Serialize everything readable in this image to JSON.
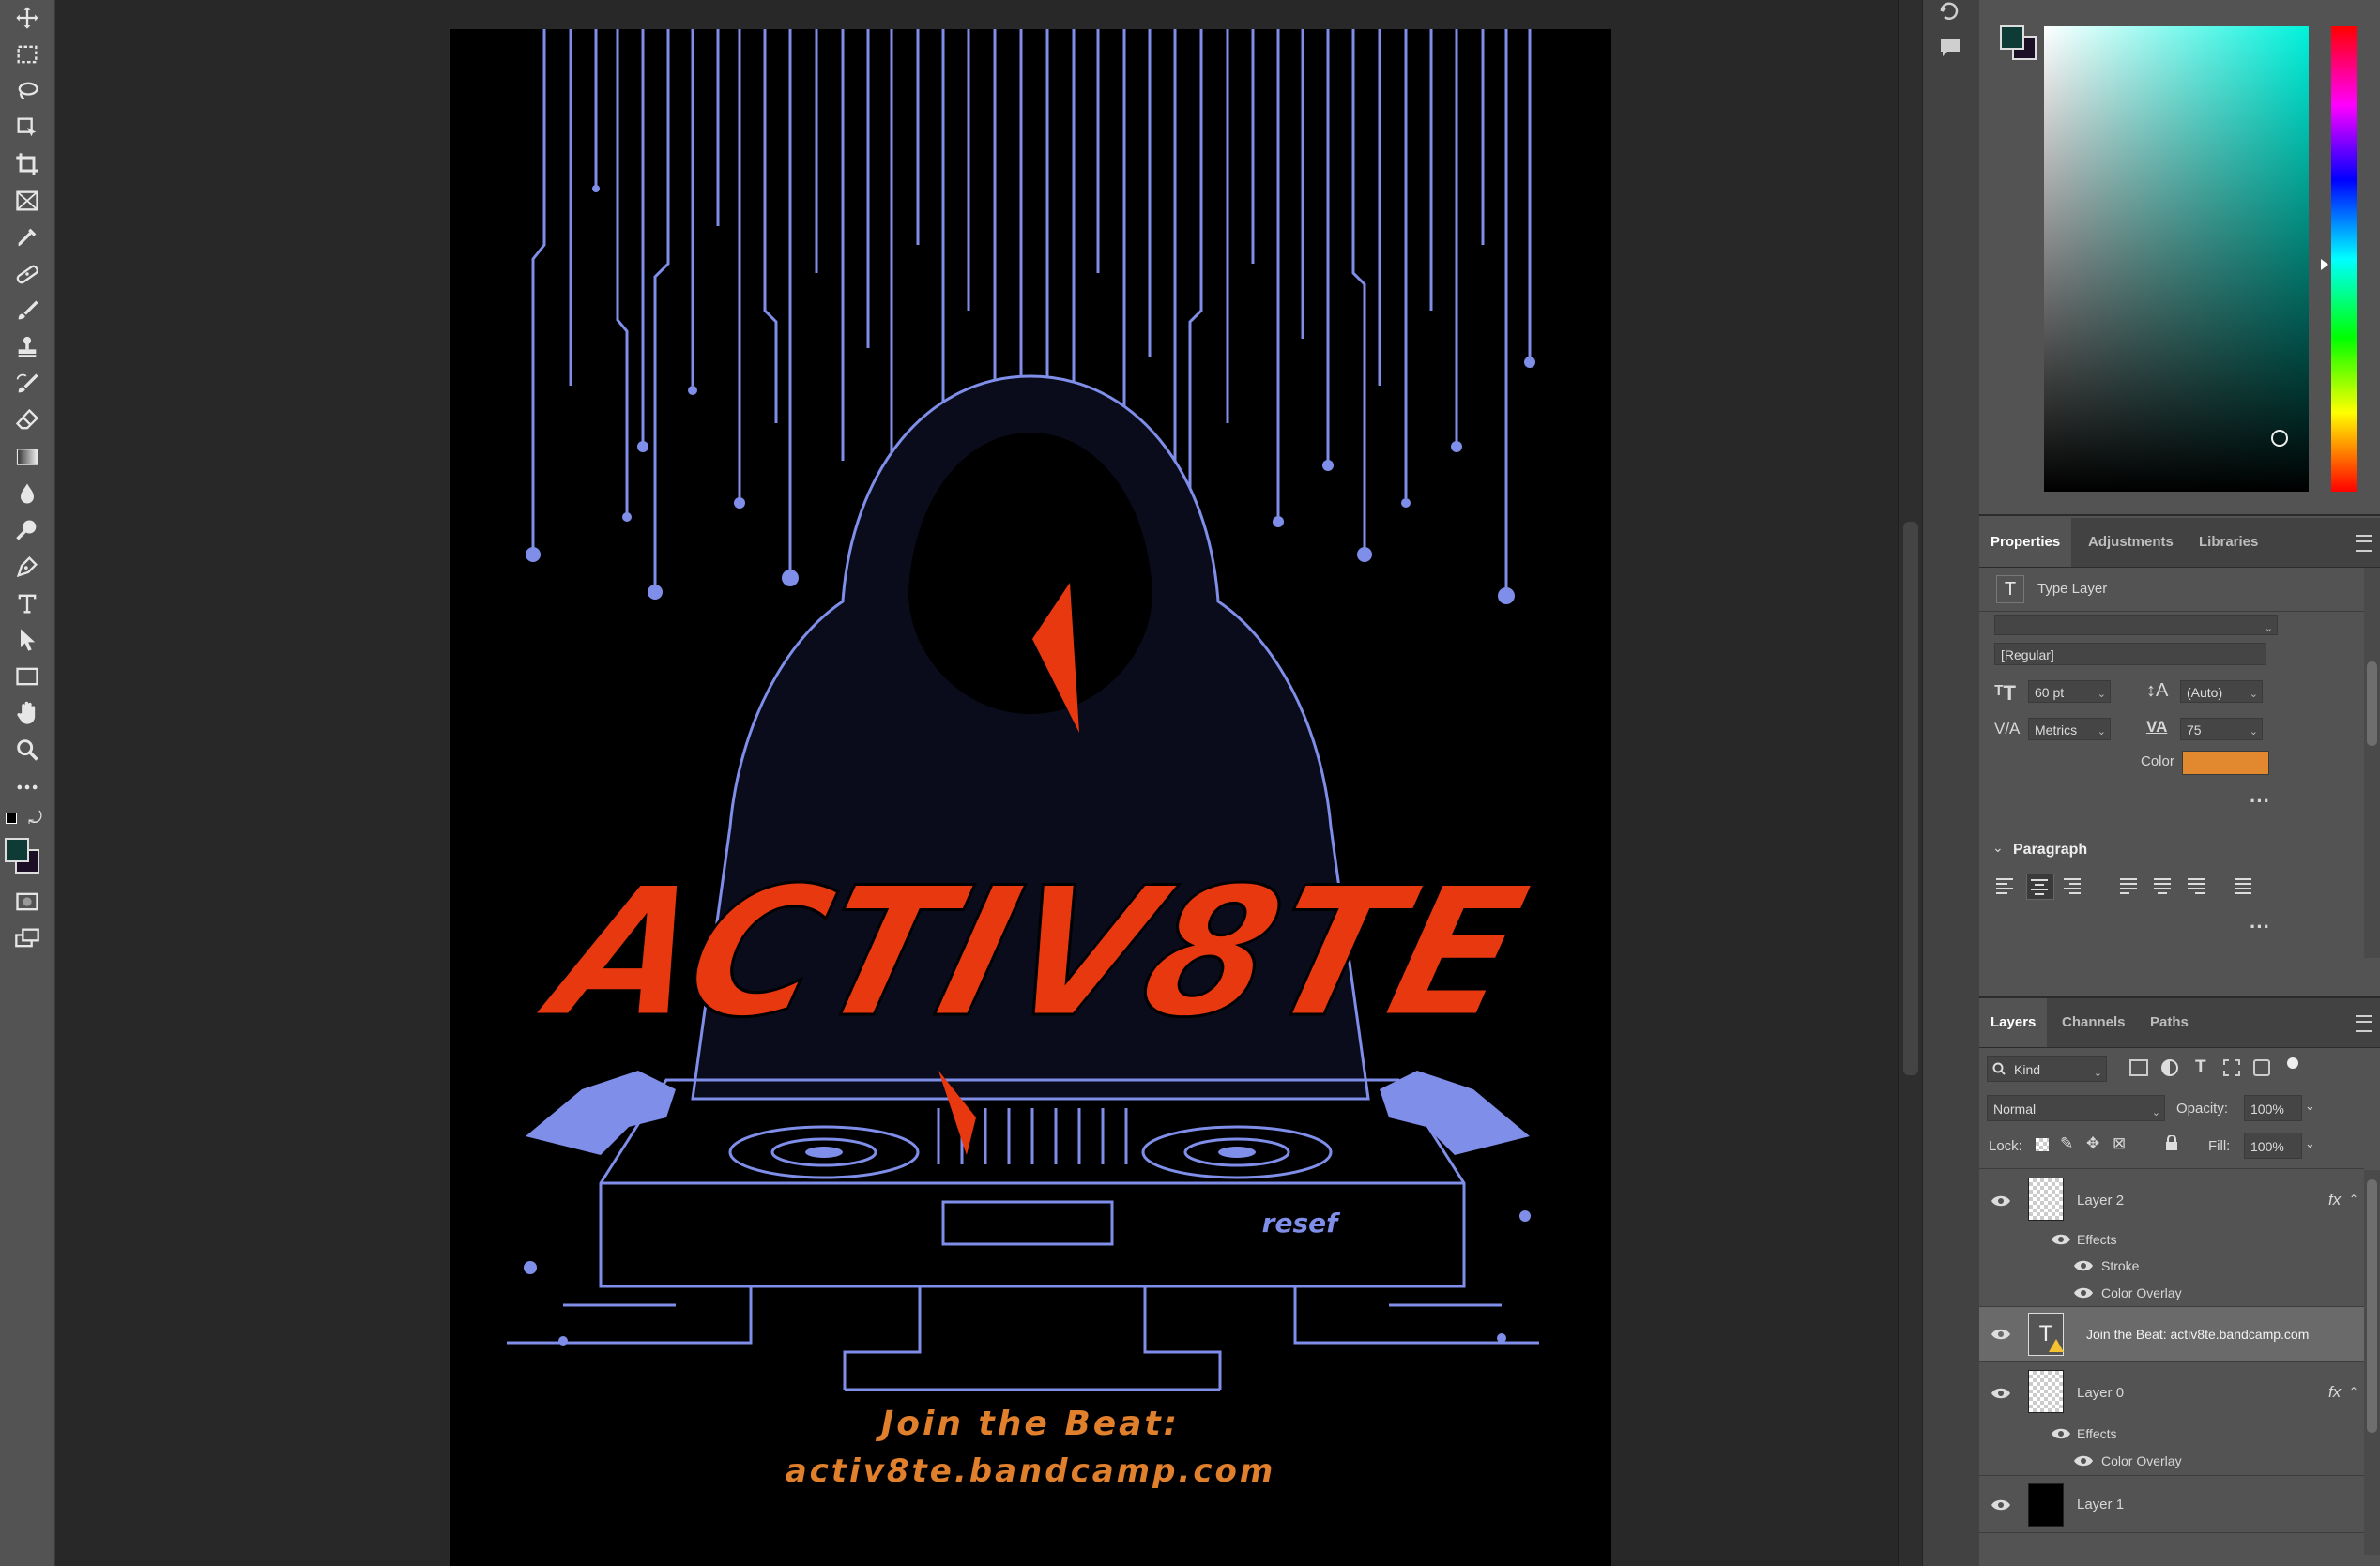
{
  "toolbar": {
    "tools": [
      "move-icon",
      "rect-marquee-icon",
      "lasso-icon",
      "object-select-icon",
      "crop-icon",
      "frame-icon",
      "eyedropper-icon",
      "spot-heal-icon",
      "brush-icon",
      "stamp-icon",
      "history-brush-icon",
      "eraser-icon",
      "gradient-icon",
      "blur-icon",
      "dodge-icon",
      "pen-icon",
      "type-icon",
      "path-select-icon",
      "rectangle-icon",
      "hand-icon",
      "zoom-icon",
      "more-icon"
    ],
    "foreground_color": "#0f3b36",
    "background_color": "#1b0f26"
  },
  "artwork": {
    "logo_text": "ACTIV8TE",
    "deck_brand": "resef",
    "line1": "Join the Beat:",
    "line2": "activ8te.bandcamp.com",
    "accent_red": "#e8380f",
    "text_orange": "#e07f2c",
    "line_blue": "#7f8ee8"
  },
  "properties_panel": {
    "tabs": [
      "Properties",
      "Adjustments",
      "Libraries"
    ],
    "active_tab": "Properties",
    "layer_kind": "Type Layer",
    "font_style": "[Regular]",
    "font_size": "60 pt",
    "leading": "(Auto)",
    "kerning": "Metrics",
    "tracking": "75",
    "color_label": "Color",
    "color_value": "#e2882f",
    "paragraph_label": "Paragraph"
  },
  "layers_panel": {
    "tabs": [
      "Layers",
      "Channels",
      "Paths"
    ],
    "active_tab": "Layers",
    "filter_kind": "Kind",
    "blend_mode": "Normal",
    "opacity_label": "Opacity:",
    "opacity": "100%",
    "lock_label": "Lock:",
    "fill_label": "Fill:",
    "fill": "100%",
    "layers": [
      {
        "name": "Layer 2",
        "fx": "fx",
        "effects_label": "Effects",
        "effects": [
          "Stroke",
          "Color Overlay"
        ]
      },
      {
        "name": "Join the Beat: activ8te.bandcamp.com"
      },
      {
        "name": "Layer 0",
        "fx": "fx",
        "effects_label": "Effects",
        "effects": [
          "Color Overlay"
        ]
      },
      {
        "name": "Layer 1"
      }
    ]
  }
}
